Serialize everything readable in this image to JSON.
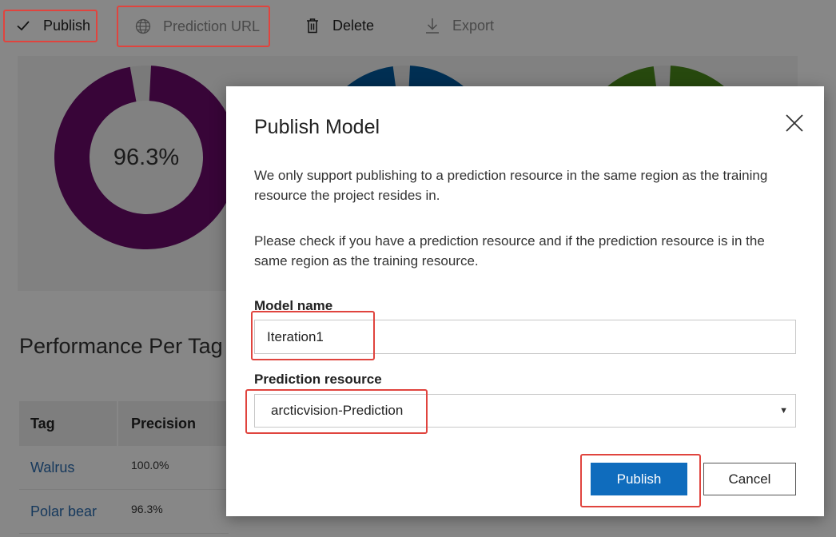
{
  "toolbar": {
    "publish_label": "Publish",
    "prediction_url_label": "Prediction URL",
    "delete_label": "Delete",
    "export_label": "Export"
  },
  "metrics": {
    "donuts": [
      {
        "value_text": "96.3%",
        "fraction": 0.963,
        "color": "#6b0a6b"
      },
      {
        "value_text": "",
        "fraction": 0.97,
        "color": "#005a9e"
      },
      {
        "value_text": "",
        "fraction": 0.97,
        "color": "#4a8a1c"
      }
    ]
  },
  "performance": {
    "title": "Performance Per Tag",
    "columns": [
      "Tag",
      "Precision"
    ],
    "rows": [
      {
        "tag": "Walrus",
        "precision": "100.0%"
      },
      {
        "tag": "Polar bear",
        "precision": "96.3%"
      }
    ]
  },
  "dialog": {
    "title": "Publish Model",
    "paragraph1": "We only support publishing to a prediction resource in the same region as the training resource the project resides in.",
    "paragraph2": "Please check if you have a prediction resource and if the prediction resource is in the same region as the training resource.",
    "model_name_label": "Model name",
    "model_name_value": "Iteration1",
    "prediction_resource_label": "Prediction resource",
    "prediction_resource_value": "arcticvision-Prediction",
    "publish_button": "Publish",
    "cancel_button": "Cancel"
  },
  "colors": {
    "accent": "#0f6cbd",
    "highlight": "#e0443e",
    "link": "#2b6cb0"
  },
  "icons": {
    "publish": "checkmark-icon",
    "prediction_url": "globe-icon",
    "delete": "trash-icon",
    "export": "download-icon",
    "close": "close-icon",
    "select": "chevron-down-icon"
  }
}
